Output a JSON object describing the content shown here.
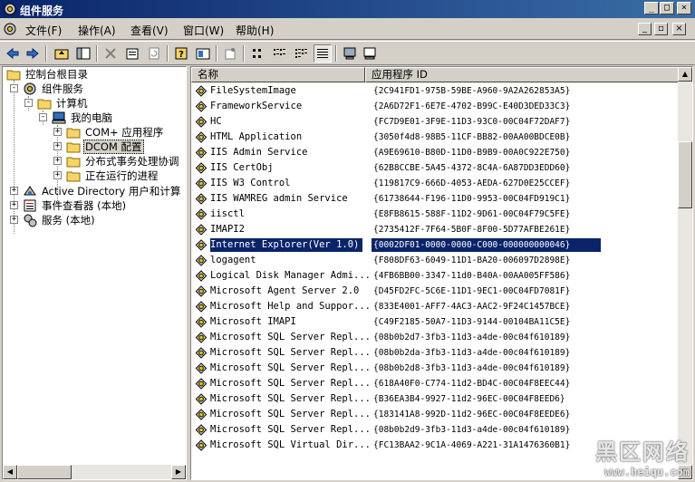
{
  "window": {
    "title": "组件服务"
  },
  "title_buttons": {
    "minimize": "_",
    "maximize": "□",
    "close": "×"
  },
  "menu": {
    "items": [
      "文件(F)",
      "操作(A)",
      "查看(V)",
      "窗口(W)",
      "帮助(H)"
    ],
    "mdi": {
      "minimize": "_",
      "restore": "▫",
      "close": "×"
    }
  },
  "toolbar": {
    "icons": [
      "back-icon",
      "forward-icon",
      "up-folder-icon",
      "show-hide-tree-icon",
      "delete-icon",
      "properties-icon",
      "refresh-icon",
      "help-icon",
      "export-list-icon",
      "new-window-icon",
      "large-icons-view-icon",
      "small-icons-view-icon",
      "list-view-icon",
      "detail-view-icon",
      "computer-icon"
    ]
  },
  "tree": {
    "items": [
      {
        "label": "控制台根目录",
        "icon": "folder-icon",
        "expander": "-"
      },
      {
        "label": "组件服务",
        "icon": "component-services-icon",
        "expander": "-"
      },
      {
        "label": "计算机",
        "icon": "folder-icon",
        "expander": "-"
      },
      {
        "label": "我的电脑",
        "icon": "computer-icon",
        "expander": "-"
      },
      {
        "label": "COM+ 应用程序",
        "icon": "folder-icon",
        "expander": "+"
      },
      {
        "label": "DCOM 配置",
        "icon": "folder-icon",
        "expander": "+",
        "selected": true
      },
      {
        "label": "分布式事务处理协调",
        "icon": "folder-icon",
        "expander": "+"
      },
      {
        "label": "正在运行的进程",
        "icon": "folder-icon",
        "expander": "+"
      },
      {
        "label": "Active Directory 用户和计算",
        "icon": "active-directory-icon",
        "expander": "+"
      },
      {
        "label": "事件查看器 (本地)",
        "icon": "event-viewer-icon",
        "expander": "+"
      },
      {
        "label": "服务 (本地)",
        "icon": "services-icon",
        "expander": "+"
      }
    ]
  },
  "list": {
    "columns": [
      "名称",
      "应用程序 ID"
    ],
    "rows": [
      {
        "name": "FileSystemImage",
        "id": "{2C941FD1-975B-59BE-A960-9A2A262853A5}"
      },
      {
        "name": "FrameworkService",
        "id": "{2A6D72F1-6E7E-4702-B99C-E40D3DED33C3}"
      },
      {
        "name": "HC",
        "id": "{FC7D9E01-3F9E-11D3-93C0-00C04F72DAF7}"
      },
      {
        "name": "HTML Application",
        "id": "{3050f4d8-98B5-11CF-BB82-00AA00BDCE0B}"
      },
      {
        "name": "IIS Admin Service",
        "id": "{A9E69610-B80D-11D0-B9B9-00A0C922E750}"
      },
      {
        "name": "IIS CertObj",
        "id": "{62B8CCBE-5A45-4372-8C4A-6A87DD3EDD60}"
      },
      {
        "name": "IIS W3 Control",
        "id": "{119817C9-666D-4053-AEDA-627D0E25CCEF}"
      },
      {
        "name": "IIS WAMREG admin Service",
        "id": "{61738644-F196-11D0-9953-00C04FD919C1}"
      },
      {
        "name": "iisctl",
        "id": "{E8FB8615-588F-11D2-9D61-00C04F79C5FE}"
      },
      {
        "name": "IMAPI2",
        "id": "{2735412F-7F64-5B0F-8F00-5D77AFBE261E}"
      },
      {
        "name": "Internet Explorer(Ver 1.0)",
        "id": "{0002DF01-0000-0000-C000-000000000046}",
        "selected": true
      },
      {
        "name": "logagent",
        "id": "{F808DF63-6049-11D1-BA20-006097D2898E}"
      },
      {
        "name": "Logical Disk Manager Admi...",
        "id": "{4FB6BB00-3347-11d0-B40A-00AA005FF586}"
      },
      {
        "name": "Microsoft Agent Server 2.0",
        "id": "{D45FD2FC-5C6E-11D1-9EC1-00C04FD7081F}"
      },
      {
        "name": "Microsoft Help and Suppor...",
        "id": "{833E4001-AFF7-4AC3-AAC2-9F24C1457BCE}"
      },
      {
        "name": "Microsoft IMAPI",
        "id": "{C49F2185-50A7-11D3-9144-00104BA11C5E}"
      },
      {
        "name": "Microsoft SQL Server Repl...",
        "id": "{08b0b2d7-3fb3-11d3-a4de-00c04f610189}"
      },
      {
        "name": "Microsoft SQL Server Repl...",
        "id": "{08b0b2da-3fb3-11d3-a4de-00c04f610189}"
      },
      {
        "name": "Microsoft SQL Server Repl...",
        "id": "{08b0b2d8-3fb3-11d3-a4de-00c04f610189}"
      },
      {
        "name": "Microsoft SQL Server Repl...",
        "id": "{618A40F0-C774-11d2-BD4C-00C04F8EEC44}"
      },
      {
        "name": "Microsoft SQL Server Repl...",
        "id": "{B36EA3B4-9927-11d2-96EC-00C04F8EED6}"
      },
      {
        "name": "Microsoft SQL Server Repl...",
        "id": "{183141A8-992D-11d2-96EC-00C04F8EEDE6}"
      },
      {
        "name": "Microsoft SQL Server Repl...",
        "id": "{08b0b2d9-3fb3-11d3-a4de-00c04f610189}"
      },
      {
        "name": "Microsoft SQL Virtual Dir...",
        "id": "{FC13BAA2-9C1A-4069-A221-31A1476360B1}"
      }
    ]
  },
  "watermark": {
    "text": "黑区网络",
    "url": "www.heiqu.com"
  }
}
